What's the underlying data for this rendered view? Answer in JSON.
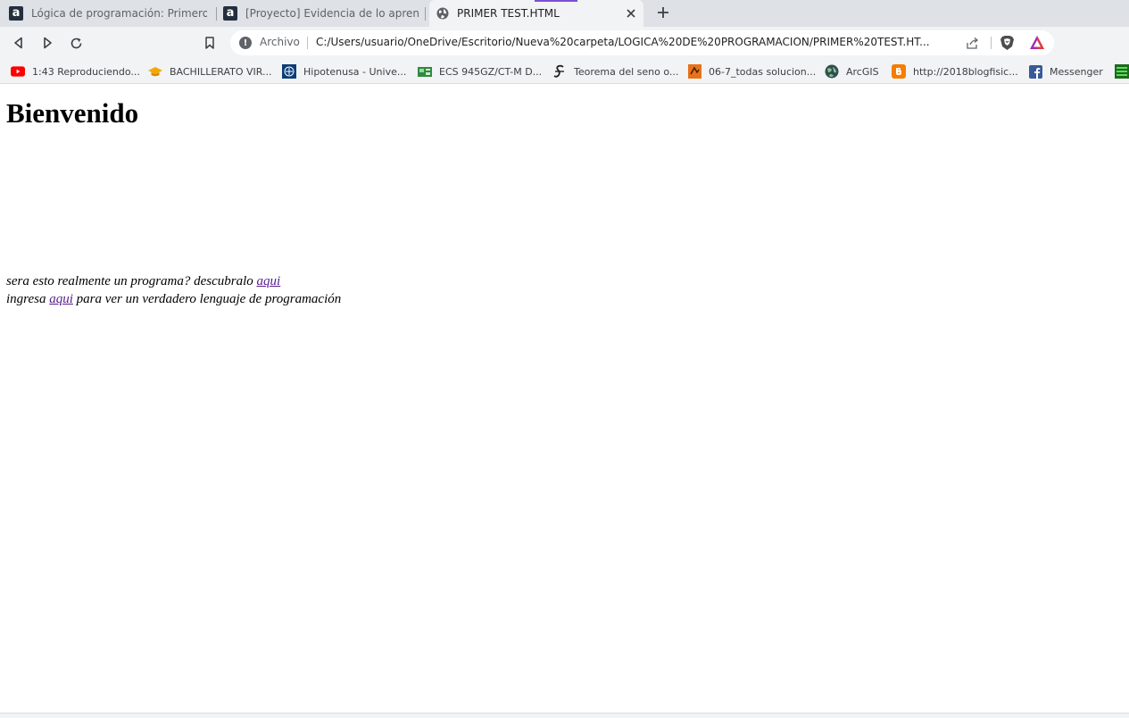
{
  "tabs": [
    {
      "label": "Lógica de programación: Primeros pas",
      "favicon": "alura-a-icon",
      "active": false
    },
    {
      "label": "[Proyecto] Evidencia de lo aprendido |",
      "favicon": "alura-a-icon",
      "active": false
    },
    {
      "label": "PRIMER TEST.HTML",
      "favicon": "globe-icon",
      "active": true
    }
  ],
  "toolbar": {
    "security_label": "Archivo",
    "url": "C:/Users/usuario/OneDrive/Escritorio/Nueva%20carpeta/LOGICA%20DE%20PROGRAMACION/PRIMER%20TEST.HT..."
  },
  "bookmarks": [
    {
      "label": "1:43 Reproduciendo...",
      "icon": "youtube-icon"
    },
    {
      "label": "BACHILLERATO VIR...",
      "icon": "graduation-cap-icon"
    },
    {
      "label": "Hipotenusa - Unive...",
      "icon": "university-seal-icon"
    },
    {
      "label": "ECS 945GZ/CT-M D...",
      "icon": "motherboard-icon"
    },
    {
      "label": "Teorema del seno o...",
      "icon": "math-s-icon"
    },
    {
      "label": "06-7_todas solucion...",
      "icon": "document-icon"
    },
    {
      "label": "ArcGIS",
      "icon": "globe-dark-icon"
    },
    {
      "label": "http://2018blogfisic...",
      "icon": "blogger-icon"
    },
    {
      "label": "Messenger",
      "icon": "facebook-icon"
    }
  ],
  "page": {
    "heading": "Bienvenido",
    "line1_text": "sera esto realmente un programa? descubralo ",
    "line1_link": "aqui",
    "line2_before": "ingresa ",
    "line2_link": "aqui",
    "line2_after": " para ver un verdadero lenguaje de programación"
  },
  "colors": {
    "tabstrip": "#dee1e6",
    "toolbar": "#f1f3f4",
    "visited_link": "#551a8b",
    "media_indicator": "#7b4fd6"
  }
}
